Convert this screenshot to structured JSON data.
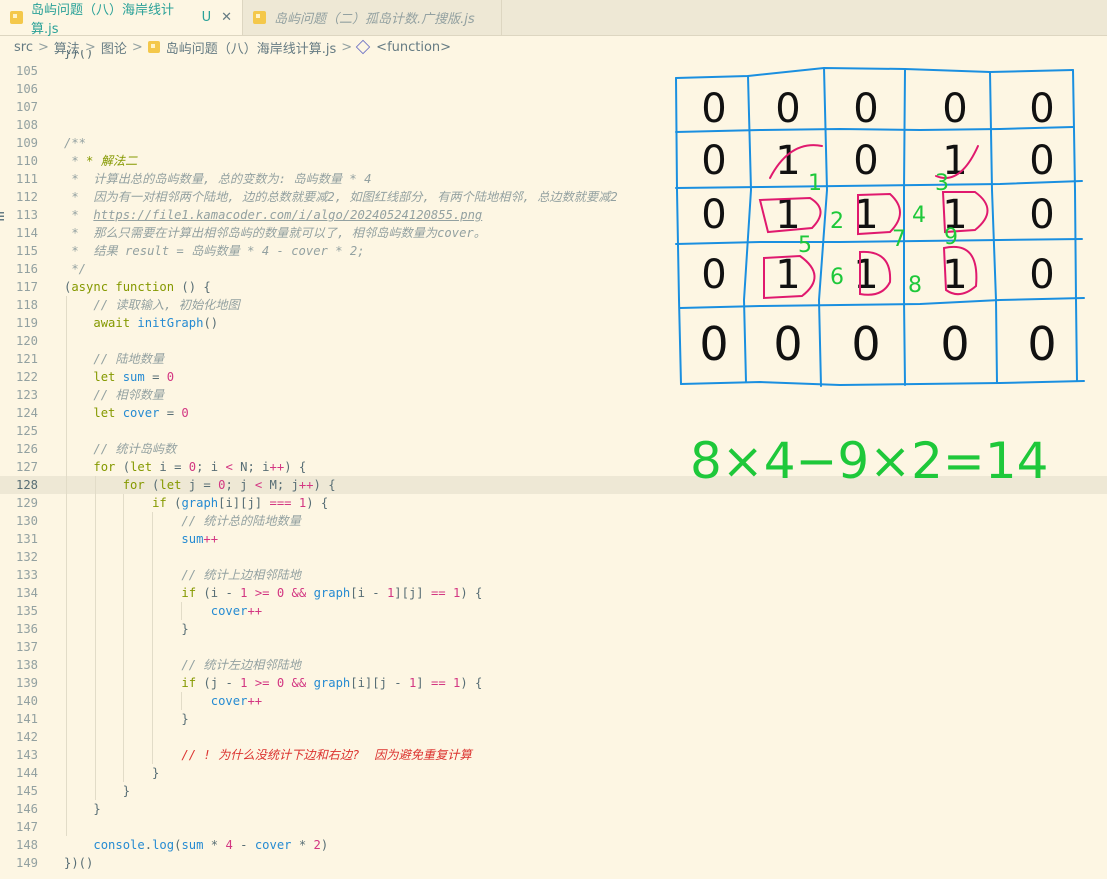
{
  "tabs": [
    {
      "label": "岛屿问题（八）海岸线计算.js",
      "modified": "U",
      "close": "✕"
    },
    {
      "label": "岛屿问题（二）孤岛计数.广搜版.js"
    }
  ],
  "breadcrumb": {
    "items": [
      "src",
      "算法",
      "图论",
      "岛屿问题（八）海岸线计算.js",
      "<function>"
    ],
    "separator": ">"
  },
  "editor": {
    "partial_top": "})()",
    "lines": [
      {
        "n": "105",
        "t": ""
      },
      {
        "n": "106",
        "t": ""
      },
      {
        "n": "107",
        "t": ""
      },
      {
        "n": "108",
        "t": ""
      },
      {
        "n": "109",
        "t": "/**"
      },
      {
        "n": "110",
        "t": " * * 解法二"
      },
      {
        "n": "111",
        "t": " *  计算出总的岛屿数量, 总的变数为: 岛屿数量 * 4"
      },
      {
        "n": "112",
        "t": " *  因为有一对相邻两个陆地, 边的总数就要减2, 如图红线部分, 有两个陆地相邻, 总边数就要减2"
      },
      {
        "n": "113",
        "t": " *  https://file1.kamacoder.com/i/algo/20240524120855.png"
      },
      {
        "n": "114",
        "t": " *  那么只需要在计算出相邻岛屿的数量就可以了, 相邻岛屿数量为cover。"
      },
      {
        "n": "115",
        "t": " *  结果 result = 岛屿数量 * 4 - cover * 2;"
      },
      {
        "n": "116",
        "t": " */"
      },
      {
        "n": "117",
        "t": "(async function () {"
      },
      {
        "n": "118",
        "t": "    // 读取输入, 初始化地图"
      },
      {
        "n": "119",
        "t": "    await initGraph()"
      },
      {
        "n": "120",
        "t": ""
      },
      {
        "n": "121",
        "t": "    // 陆地数量"
      },
      {
        "n": "122",
        "t": "    let sum = 0"
      },
      {
        "n": "123",
        "t": "    // 相邻数量"
      },
      {
        "n": "124",
        "t": "    let cover = 0"
      },
      {
        "n": "125",
        "t": ""
      },
      {
        "n": "126",
        "t": "    // 统计岛屿数"
      },
      {
        "n": "127",
        "t": "    for (let i = 0; i < N; i++) {"
      },
      {
        "n": "128",
        "t": "        for (let j = 0; j < M; j++) {"
      },
      {
        "n": "129",
        "t": "            if (graph[i][j] === 1) {"
      },
      {
        "n": "130",
        "t": "                // 统计总的陆地数量"
      },
      {
        "n": "131",
        "t": "                sum++"
      },
      {
        "n": "132",
        "t": ""
      },
      {
        "n": "133",
        "t": "                // 统计上边相邻陆地"
      },
      {
        "n": "134",
        "t": "                if (i - 1 >= 0 && graph[i - 1][j] == 1) {"
      },
      {
        "n": "135",
        "t": "                    cover++"
      },
      {
        "n": "136",
        "t": "                }"
      },
      {
        "n": "137",
        "t": ""
      },
      {
        "n": "138",
        "t": "                // 统计左边相邻陆地"
      },
      {
        "n": "139",
        "t": "                if (j - 1 >= 0 && graph[i][j - 1] == 1) {"
      },
      {
        "n": "140",
        "t": "                    cover++"
      },
      {
        "n": "141",
        "t": "                }"
      },
      {
        "n": "142",
        "t": ""
      },
      {
        "n": "143",
        "t": "                // ! 为什么没统计下边和右边?  因为避免重复计算"
      },
      {
        "n": "144",
        "t": "            }"
      },
      {
        "n": "145",
        "t": "        }"
      },
      {
        "n": "146",
        "t": "    }"
      },
      {
        "n": "147",
        "t": ""
      },
      {
        "n": "148",
        "t": "    console.log(sum * 4 - cover * 2)"
      },
      {
        "n": "149",
        "t": "})()"
      }
    ]
  },
  "sketch": {
    "grid_cells": [
      [
        "0",
        "0",
        "0",
        "0",
        "0"
      ],
      [
        "0",
        "1",
        "0",
        "1",
        "0"
      ],
      [
        "0",
        "1",
        "1",
        "1",
        "0"
      ],
      [
        "0",
        "1",
        "1",
        "1",
        "0"
      ],
      [
        "0",
        "0",
        "0",
        "0",
        "0"
      ]
    ],
    "edge_labels": [
      "1",
      "2",
      "3",
      "4",
      "5",
      "6",
      "7",
      "8",
      "9"
    ],
    "equation": "8×4−9×2=14",
    "colors": {
      "grid": "#1a8fe0",
      "land": "#e0196e",
      "labels": "#1ec83a"
    }
  }
}
